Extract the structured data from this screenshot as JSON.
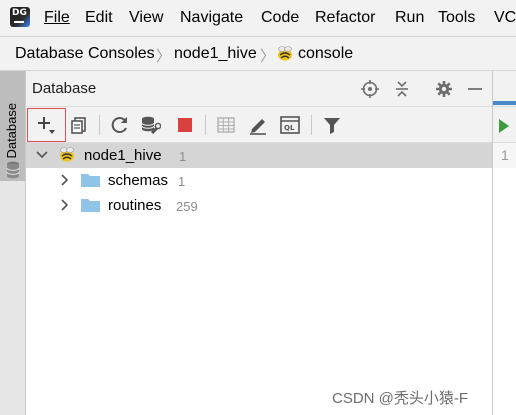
{
  "menubar": {
    "app_logo_text": "DG",
    "items": [
      "File",
      "Edit",
      "View",
      "Navigate",
      "Code",
      "Refactor",
      "Run",
      "Tools",
      "VCS"
    ]
  },
  "breadcrumb": {
    "items": [
      "Database Consoles",
      "node1_hive",
      "console"
    ]
  },
  "left_stripe": {
    "tab_label": "1: Database"
  },
  "database_panel": {
    "title": "Database",
    "header_icons": [
      "crosshair-icon",
      "collapse-icon",
      "gear-icon",
      "minimize-icon"
    ],
    "toolbar_icons": [
      "add-icon",
      "duplicate-icon",
      "refresh-icon",
      "data-source-properties-icon",
      "stop-icon",
      "table-icon",
      "edit-icon",
      "query-console-icon",
      "filter-icon"
    ]
  },
  "tree": {
    "root": {
      "label": "node1_hive",
      "count": "1"
    },
    "children": [
      {
        "label": "schemas",
        "count": "1"
      },
      {
        "label": "routines",
        "count": "259"
      }
    ]
  },
  "editor": {
    "line_number": "1"
  },
  "watermark": "CSDN @秃头小猿-F",
  "colors": {
    "accent": "#4a88c7",
    "selection": "#d5d5d5",
    "folder": "#8fc3e8",
    "stop": "#d94040",
    "run": "#3e9c3e",
    "highlight_box": "#e05050"
  }
}
